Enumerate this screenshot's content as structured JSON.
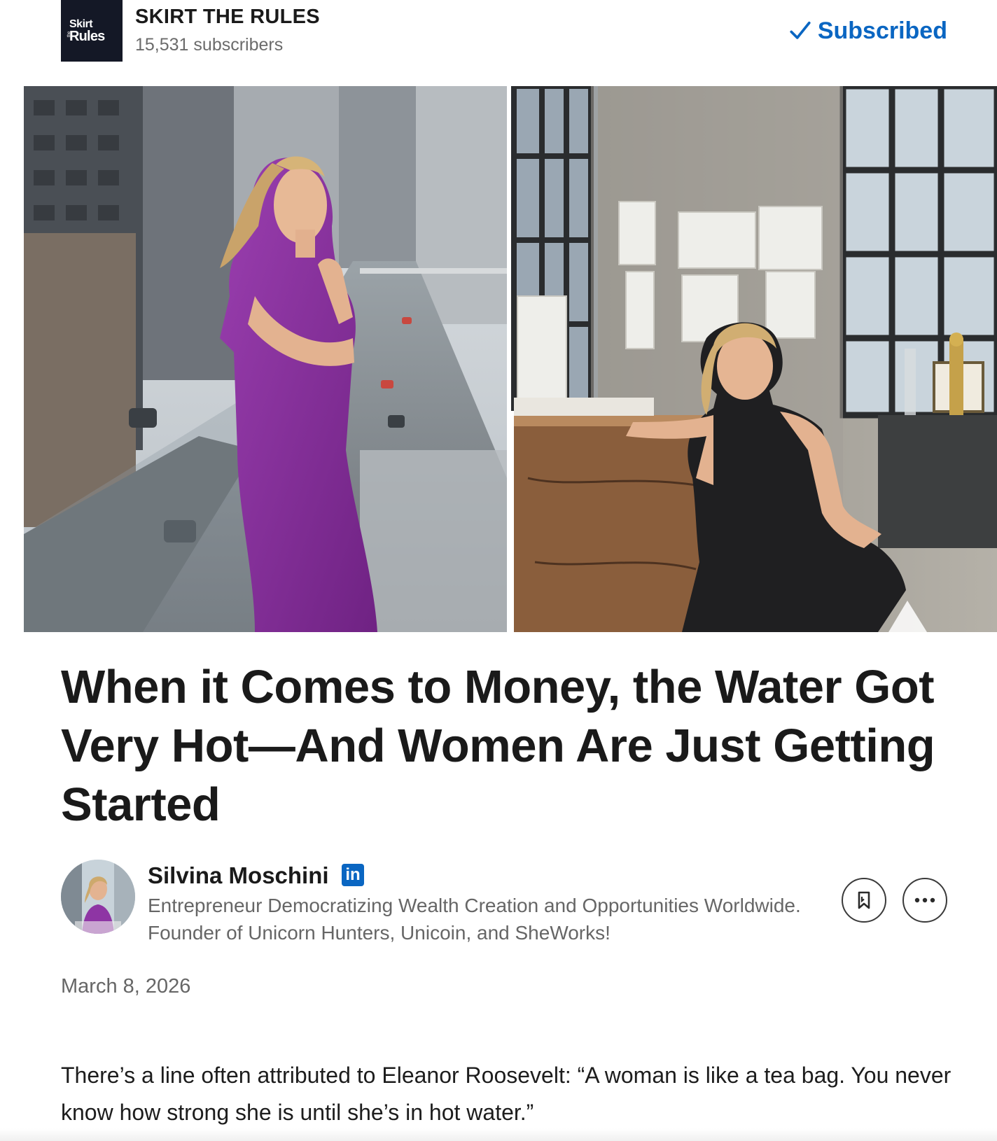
{
  "newsletter": {
    "logo_top": "Skirt",
    "logo_small": "the",
    "logo_bottom": "Rules",
    "name": "SKIRT THE RULES",
    "subscribers": "15,531 subscribers",
    "subscribe_state": "Subscribed",
    "accent_color": "#0a66c2"
  },
  "hero": {
    "panels": 2,
    "left_panel_icon": "photo-woman-balcony",
    "right_panel_icon": "photo-woman-loft"
  },
  "article": {
    "title": "When it Comes to Money, the Water Got Very Hot—And Women Are Just Getting Started",
    "date": "March 8, 2026",
    "body_first_paragraph": "There’s a line often attributed to Eleanor Roosevelt: “A woman is like a tea bag. You never know how strong she is until she’s in hot water.”"
  },
  "author": {
    "name": "Silvina Moschini",
    "badge": "in",
    "bio": "Entrepreneur Democratizing Wealth Creation and Opportunities Worldwide. Founder of Unicorn Hunters, Unicoin, and SheWorks!"
  },
  "actions": {
    "bookmark_icon": "bookmark-icon",
    "more_icon": "more-icon"
  }
}
